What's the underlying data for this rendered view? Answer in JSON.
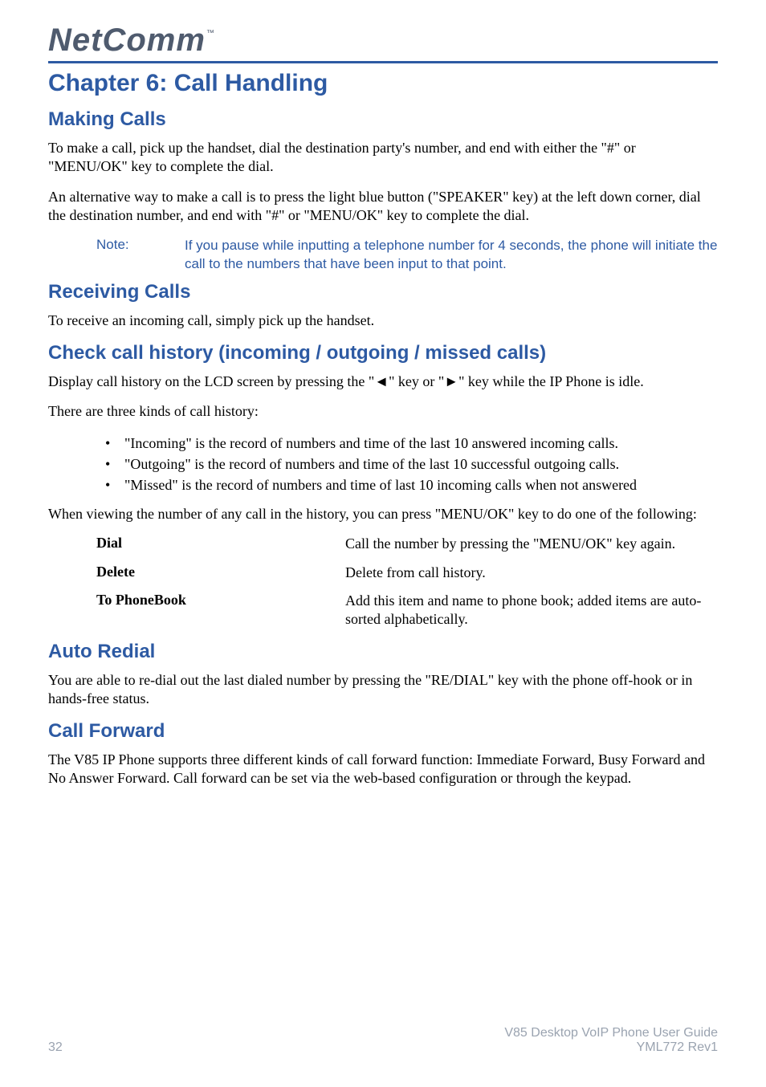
{
  "logo": "NetComm",
  "chapter_title": "Chapter 6: Call Handling",
  "sections": {
    "making_calls": {
      "title": "Making Calls",
      "para1": "To make a call, pick up the handset, dial the destination party's number, and end with either the \"#\" or \"MENU/OK\" key to complete the dial.",
      "para2": "An alternative way to make a call is to press the light blue button (\"SPEAKER\" key) at the left down corner, dial the destination number, and end with \"#\" or \"MENU/OK\" key to complete the dial.",
      "note_label": "Note:",
      "note_text": "If you pause while inputting a telephone number for 4 seconds, the phone will initiate the call to the numbers that have been input to that point."
    },
    "receiving_calls": {
      "title": "Receiving Calls",
      "para1": "To receive an incoming call, simply pick up the handset."
    },
    "check_history": {
      "title": "Check call history (incoming / outgoing / missed calls)",
      "para1": "Display call history on the LCD screen by pressing the \"◄\" key or \"►\" key while the IP Phone is idle.",
      "para2": "There are three kinds of call history:",
      "bullets": [
        "\"Incoming\" is the record of numbers and time of the last 10 answered incoming calls.",
        "\"Outgoing\" is the record of numbers and time of the last 10 successful outgoing calls.",
        "\"Missed\" is the record of numbers and time of last 10 incoming calls when not answered"
      ],
      "para3": "When viewing the number of any call in the history, you can press \"MENU/OK\" key to do one of the following:",
      "actions": [
        {
          "label": "Dial",
          "desc": "Call the number by pressing the \"MENU/OK\" key again."
        },
        {
          "label": "Delete",
          "desc": "Delete from call history."
        },
        {
          "label": "To PhoneBook",
          "desc": "Add this item and name to phone book; added items are auto-sorted alphabetically."
        }
      ]
    },
    "auto_redial": {
      "title": "Auto Redial",
      "para1": "You are able to re-dial out the last dialed number by pressing the \"RE/DIAL\" key with the phone off-hook or in hands-free status."
    },
    "call_forward": {
      "title": "Call Forward",
      "para1": "The V85 IP Phone supports three different kinds of call forward function: Immediate Forward, Busy Forward and No Answer Forward.   Call forward can be set via the web-based configuration or through the keypad."
    }
  },
  "footer": {
    "page": "32",
    "guide": "V85 Desktop VoIP Phone User Guide",
    "rev": "YML772 Rev1"
  }
}
